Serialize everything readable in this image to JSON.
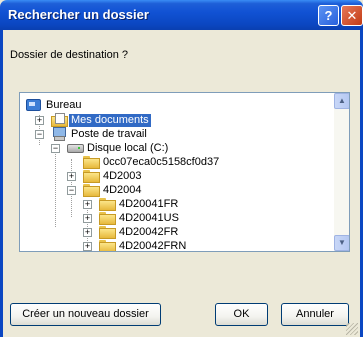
{
  "window": {
    "title": "Rechercher un dossier",
    "help_label": "?",
    "close_label": "✕"
  },
  "prompt": "Dossier de destination ?",
  "tree": {
    "nodes": [
      {
        "label": "Bureau",
        "icon": "desktop-icon",
        "expander": ""
      },
      {
        "label": "Mes documents",
        "icon": "documents-folder-icon",
        "expander": "+",
        "selected": true
      },
      {
        "label": "Poste de travail",
        "icon": "computer-icon",
        "expander": "−"
      },
      {
        "label": "Disque local (C:)",
        "icon": "hard-disk-icon",
        "expander": "−"
      },
      {
        "label": "0cc07eca0c5158cf0d37",
        "icon": "folder-icon",
        "expander": ""
      },
      {
        "label": "4D2003",
        "icon": "folder-icon",
        "expander": "+"
      },
      {
        "label": "4D2004",
        "icon": "folder-icon",
        "expander": "−"
      },
      {
        "label": "4D20041FR",
        "icon": "folder-icon",
        "expander": "+"
      },
      {
        "label": "4D20041US",
        "icon": "folder-icon",
        "expander": "+"
      },
      {
        "label": "4D20042FR",
        "icon": "folder-icon",
        "expander": "+"
      },
      {
        "label": "4D20042FRN",
        "icon": "folder-icon",
        "expander": "+"
      }
    ],
    "scroll_up_label": "▲",
    "scroll_down_label": "▼"
  },
  "buttons": {
    "new_folder": "Créer un nouveau dossier",
    "ok": "OK",
    "cancel": "Annuler"
  },
  "colors": {
    "titlebar": "#0b47c2",
    "selection": "#316ac5",
    "dialog_bg": "#ece9d8"
  }
}
